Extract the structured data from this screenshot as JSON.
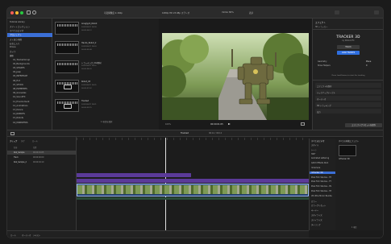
{
  "toolbar": {
    "left_labels": [
      "Final Cut Pro",
      "再生",
      "編集"
    ],
    "format_label": "可変解像度 2,160p",
    "viewer_label": "1080p HD 23.98p ステレオ",
    "scale_label": "Vimbo 80%",
    "view_label": "表示",
    "inspector_title": "エフェクト",
    "inspector_sub": "3D トラッカー"
  },
  "library": {
    "items": [
      {
        "label": "Tutorial Library",
        "sel": false
      },
      {
        "label": "スマートコレクション",
        "sel": false
      },
      {
        "label": "すべてのビデオ",
        "sel": false
      },
      {
        "label": "プロジェクト",
        "sel": true
      },
      {
        "label": "よく使う項目",
        "sel": false
      },
      {
        "label": "お気に入り",
        "sel": false
      },
      {
        "label": "Drone",
        "sel": false
      },
      {
        "label": "カメラ",
        "sel": false
      },
      {
        "label": "撮影",
        "sel": false
      },
      {
        "label": "01_TrackerGroup",
        "sel": false
      },
      {
        "label": "02_Backgrounds",
        "sel": false
      },
      {
        "label": "03_SHAKES",
        "sel": false
      },
      {
        "label": "04_Jeep",
        "sel": false
      },
      {
        "label": "05_INTERFACE",
        "sel": false
      },
      {
        "label": "06_Hot",
        "sel": false
      },
      {
        "label": "07_STOCK",
        "sel": false
      },
      {
        "label": "08_ELEMENTS",
        "sel": false
      },
      {
        "label": "09_Grenades",
        "sel": false
      },
      {
        "label": "10_SoundFX",
        "sel": false
      },
      {
        "label": "11_Environment",
        "sel": false
      },
      {
        "label": "12_Animations",
        "sel": false
      },
      {
        "label": "13_Dance",
        "sel": false
      },
      {
        "label": "14_ROBOTS",
        "sel": false
      },
      {
        "label": "15_Robots",
        "sel": false
      },
      {
        "label": "16_MONSTERS",
        "sel": false
      }
    ]
  },
  "browser": {
    "clips": [
      {
        "name": "Anaglyph_Robot",
        "meta": "2023/09/07 18:18",
        "meta2": "00:00:06:12"
      },
      {
        "name": "Hands_Robot_2",
        "meta": "2023/09/07 18:20",
        "meta2": "00:00:05:08"
      },
      {
        "name": "トラッキング_CGI素材",
        "meta": "2023/09/07 18:22",
        "meta2": "00:00:04:20"
      },
      {
        "name": "Robot_03",
        "meta": "2023/09/07 18:25",
        "meta2": "00:00:07:02"
      },
      {
        "name": "Tracked",
        "meta": "2023/09/07 18:31",
        "meta2": "00:00:03:15"
      }
    ],
    "footer": "1 項目を選択"
  },
  "viewer": {
    "timecode": "00:00:01:05",
    "zoom": "100%"
  },
  "inspector": {
    "plugin_title": "TRACKER 3D",
    "plugin_by": "by MotionVFX",
    "track_button": "TRACK",
    "load_button": "LOAD FRAMES",
    "param1_label": "Geometry",
    "param1_value": "Plane",
    "param2_label": "Show Helpers",
    "param2_value": "0",
    "hint": "Press Load Frames to start the tracking",
    "fields": [
      "エフェクトを保存",
      "ルックアップテーブル",
      "オーディオ",
      "3D トラッキング",
      "出力"
    ],
    "save_button": "エフェクトプリセットを保存"
  },
  "timeline": {
    "project_title": "Tracked",
    "duration": "06:12 / 06:12",
    "index_tabs": [
      "クリップ",
      "タグ",
      "ロール"
    ],
    "index_rows": [
      {
        "name": "Rob_Sample",
        "time": "00:00:01:05"
      },
      {
        "name": "Track",
        "time": "00:00:00:00"
      },
      {
        "name": "Rob_Sample_2",
        "time": "00:00:04:10"
      }
    ],
    "index_header": [
      "名前",
      "位置"
    ],
    "footer_tabs": [
      "ロール",
      "オーディオ",
      "テキスト"
    ]
  },
  "effects": {
    "header": "すべてのビデオ",
    "items": [
      {
        "label": "スタイル",
        "sel": false
      },
      {
        "label": "トーン",
        "sel": false
      },
      {
        "label": "360°",
        "sel": false
      },
      {
        "label": "Animated Lettering",
        "sel": false
      },
      {
        "label": "Glitch Effects Pack",
        "sel": false
      },
      {
        "label": "mCamera",
        "sel": false
      },
      {
        "label": "mTracker 3D",
        "sel": true
      },
      {
        "label": "Pixel Film Studios - FP",
        "sel": false
      },
      {
        "label": "Pixel Film Studios - FT",
        "sel": false
      },
      {
        "label": "Pixel Film Studios - PS",
        "sel": false
      },
      {
        "label": "Pixel Film Studios - TP",
        "sel": false
      },
      {
        "label": "VR Ultra Mirror Bundle",
        "sel": false
      },
      {
        "label": "カラー",
        "sel": false
      },
      {
        "label": "カラープリセット",
        "sel": false
      },
      {
        "label": "キーヤー",
        "sel": false
      },
      {
        "label": "スタイライズ",
        "sel": false
      },
      {
        "label": "ステイライズ",
        "sel": false
      },
      {
        "label": "タイリング",
        "sel": false
      }
    ],
    "preview_title": "すべての内蔵エフェクト",
    "preview_item": "mTracker 3D",
    "count": "1 項目"
  },
  "colors": {
    "accent": "#2f6fe0",
    "clip_purple": "#5b3a99",
    "selection": "#3b6fd6"
  }
}
